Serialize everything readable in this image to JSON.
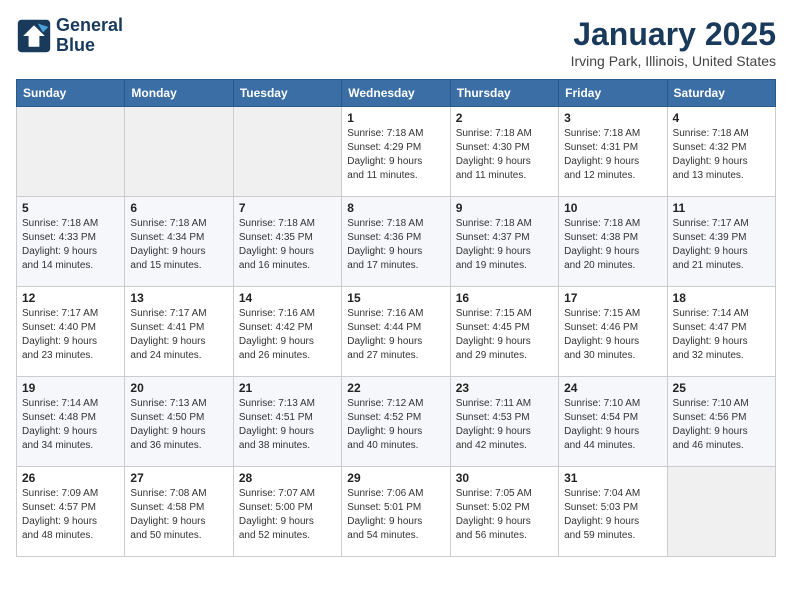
{
  "logo": {
    "line1": "General",
    "line2": "Blue"
  },
  "title": "January 2025",
  "subtitle": "Irving Park, Illinois, United States",
  "header_days": [
    "Sunday",
    "Monday",
    "Tuesday",
    "Wednesday",
    "Thursday",
    "Friday",
    "Saturday"
  ],
  "weeks": [
    [
      {
        "day": "",
        "info": ""
      },
      {
        "day": "",
        "info": ""
      },
      {
        "day": "",
        "info": ""
      },
      {
        "day": "1",
        "info": "Sunrise: 7:18 AM\nSunset: 4:29 PM\nDaylight: 9 hours\nand 11 minutes."
      },
      {
        "day": "2",
        "info": "Sunrise: 7:18 AM\nSunset: 4:30 PM\nDaylight: 9 hours\nand 11 minutes."
      },
      {
        "day": "3",
        "info": "Sunrise: 7:18 AM\nSunset: 4:31 PM\nDaylight: 9 hours\nand 12 minutes."
      },
      {
        "day": "4",
        "info": "Sunrise: 7:18 AM\nSunset: 4:32 PM\nDaylight: 9 hours\nand 13 minutes."
      }
    ],
    [
      {
        "day": "5",
        "info": "Sunrise: 7:18 AM\nSunset: 4:33 PM\nDaylight: 9 hours\nand 14 minutes."
      },
      {
        "day": "6",
        "info": "Sunrise: 7:18 AM\nSunset: 4:34 PM\nDaylight: 9 hours\nand 15 minutes."
      },
      {
        "day": "7",
        "info": "Sunrise: 7:18 AM\nSunset: 4:35 PM\nDaylight: 9 hours\nand 16 minutes."
      },
      {
        "day": "8",
        "info": "Sunrise: 7:18 AM\nSunset: 4:36 PM\nDaylight: 9 hours\nand 17 minutes."
      },
      {
        "day": "9",
        "info": "Sunrise: 7:18 AM\nSunset: 4:37 PM\nDaylight: 9 hours\nand 19 minutes."
      },
      {
        "day": "10",
        "info": "Sunrise: 7:18 AM\nSunset: 4:38 PM\nDaylight: 9 hours\nand 20 minutes."
      },
      {
        "day": "11",
        "info": "Sunrise: 7:17 AM\nSunset: 4:39 PM\nDaylight: 9 hours\nand 21 minutes."
      }
    ],
    [
      {
        "day": "12",
        "info": "Sunrise: 7:17 AM\nSunset: 4:40 PM\nDaylight: 9 hours\nand 23 minutes."
      },
      {
        "day": "13",
        "info": "Sunrise: 7:17 AM\nSunset: 4:41 PM\nDaylight: 9 hours\nand 24 minutes."
      },
      {
        "day": "14",
        "info": "Sunrise: 7:16 AM\nSunset: 4:42 PM\nDaylight: 9 hours\nand 26 minutes."
      },
      {
        "day": "15",
        "info": "Sunrise: 7:16 AM\nSunset: 4:44 PM\nDaylight: 9 hours\nand 27 minutes."
      },
      {
        "day": "16",
        "info": "Sunrise: 7:15 AM\nSunset: 4:45 PM\nDaylight: 9 hours\nand 29 minutes."
      },
      {
        "day": "17",
        "info": "Sunrise: 7:15 AM\nSunset: 4:46 PM\nDaylight: 9 hours\nand 30 minutes."
      },
      {
        "day": "18",
        "info": "Sunrise: 7:14 AM\nSunset: 4:47 PM\nDaylight: 9 hours\nand 32 minutes."
      }
    ],
    [
      {
        "day": "19",
        "info": "Sunrise: 7:14 AM\nSunset: 4:48 PM\nDaylight: 9 hours\nand 34 minutes."
      },
      {
        "day": "20",
        "info": "Sunrise: 7:13 AM\nSunset: 4:50 PM\nDaylight: 9 hours\nand 36 minutes."
      },
      {
        "day": "21",
        "info": "Sunrise: 7:13 AM\nSunset: 4:51 PM\nDaylight: 9 hours\nand 38 minutes."
      },
      {
        "day": "22",
        "info": "Sunrise: 7:12 AM\nSunset: 4:52 PM\nDaylight: 9 hours\nand 40 minutes."
      },
      {
        "day": "23",
        "info": "Sunrise: 7:11 AM\nSunset: 4:53 PM\nDaylight: 9 hours\nand 42 minutes."
      },
      {
        "day": "24",
        "info": "Sunrise: 7:10 AM\nSunset: 4:54 PM\nDaylight: 9 hours\nand 44 minutes."
      },
      {
        "day": "25",
        "info": "Sunrise: 7:10 AM\nSunset: 4:56 PM\nDaylight: 9 hours\nand 46 minutes."
      }
    ],
    [
      {
        "day": "26",
        "info": "Sunrise: 7:09 AM\nSunset: 4:57 PM\nDaylight: 9 hours\nand 48 minutes."
      },
      {
        "day": "27",
        "info": "Sunrise: 7:08 AM\nSunset: 4:58 PM\nDaylight: 9 hours\nand 50 minutes."
      },
      {
        "day": "28",
        "info": "Sunrise: 7:07 AM\nSunset: 5:00 PM\nDaylight: 9 hours\nand 52 minutes."
      },
      {
        "day": "29",
        "info": "Sunrise: 7:06 AM\nSunset: 5:01 PM\nDaylight: 9 hours\nand 54 minutes."
      },
      {
        "day": "30",
        "info": "Sunrise: 7:05 AM\nSunset: 5:02 PM\nDaylight: 9 hours\nand 56 minutes."
      },
      {
        "day": "31",
        "info": "Sunrise: 7:04 AM\nSunset: 5:03 PM\nDaylight: 9 hours\nand 59 minutes."
      },
      {
        "day": "",
        "info": ""
      }
    ]
  ]
}
